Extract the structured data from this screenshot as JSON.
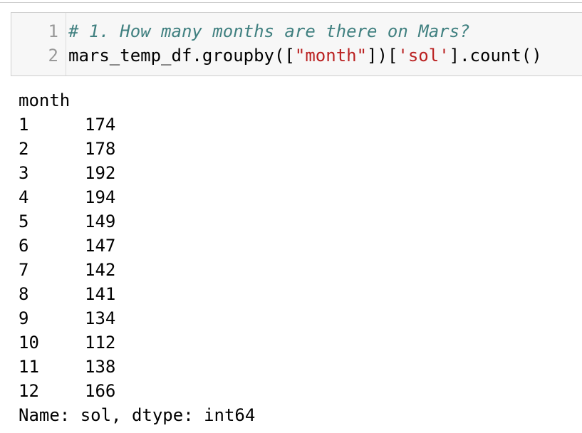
{
  "input_cell": {
    "line_numbers": [
      "1",
      "2"
    ],
    "line1": {
      "comment": "# 1. How many months are there on Mars?"
    },
    "line2": {
      "part1": "mars_temp_df.groupby([",
      "string1": "\"month\"",
      "part2": "])[",
      "string2": "'sol'",
      "part3": "].count()"
    }
  },
  "output": {
    "index_name": "month",
    "rows": [
      {
        "month": "1",
        "count": "174"
      },
      {
        "month": "2",
        "count": "178"
      },
      {
        "month": "3",
        "count": "192"
      },
      {
        "month": "4",
        "count": "194"
      },
      {
        "month": "5",
        "count": "149"
      },
      {
        "month": "6",
        "count": "147"
      },
      {
        "month": "7",
        "count": "142"
      },
      {
        "month": "8",
        "count": "141"
      },
      {
        "month": "9",
        "count": "134"
      },
      {
        "month": "10",
        "count": "112"
      },
      {
        "month": "11",
        "count": "138"
      },
      {
        "month": "12",
        "count": "166"
      }
    ],
    "footer": "Name: sol, dtype: int64"
  }
}
